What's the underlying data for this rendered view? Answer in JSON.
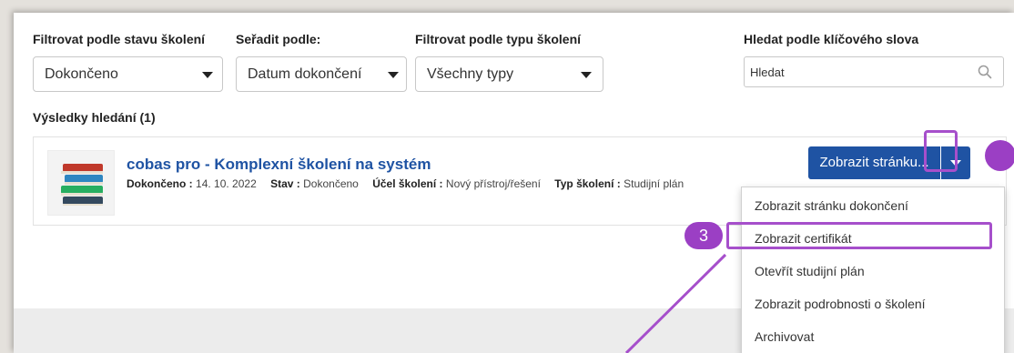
{
  "filters": {
    "status": {
      "label": "Filtrovat podle stavu školení",
      "value": "Dokončeno"
    },
    "sort": {
      "label": "Seřadit podle:",
      "value": "Datum dokončení"
    },
    "type": {
      "label": "Filtrovat podle typu školení",
      "value": "Všechny typy"
    },
    "search": {
      "label": "Hledat podle klíčového slova",
      "placeholder": "Hledat"
    }
  },
  "results": {
    "label": "Výsledky hledání (1)",
    "items": [
      {
        "title": "cobas pro - Komplexní školení na systém",
        "completed_label": "Dokončeno :",
        "completed_value": "14. 10. 2022",
        "status_label": "Stav :",
        "status_value": "Dokončeno",
        "purpose_label": "Účel školení :",
        "purpose_value": "Nový přístroj/řešení",
        "type_label": "Typ školení :",
        "type_value": "Studijní plán"
      }
    ]
  },
  "actions": {
    "main_button": "Zobrazit stránku...",
    "menu": [
      "Zobrazit stránku dokončení",
      "Zobrazit certifikát",
      "Otevřít studijní plán",
      "Zobrazit podrobnosti o školení",
      "Archivovat"
    ]
  },
  "callouts": {
    "step": "3"
  },
  "colors": {
    "primary": "#1f53a3",
    "highlight": "#a64fcb",
    "callout": "#9b3fc4",
    "page_background": "#e4e1dc",
    "footer_band": "#ececec"
  }
}
